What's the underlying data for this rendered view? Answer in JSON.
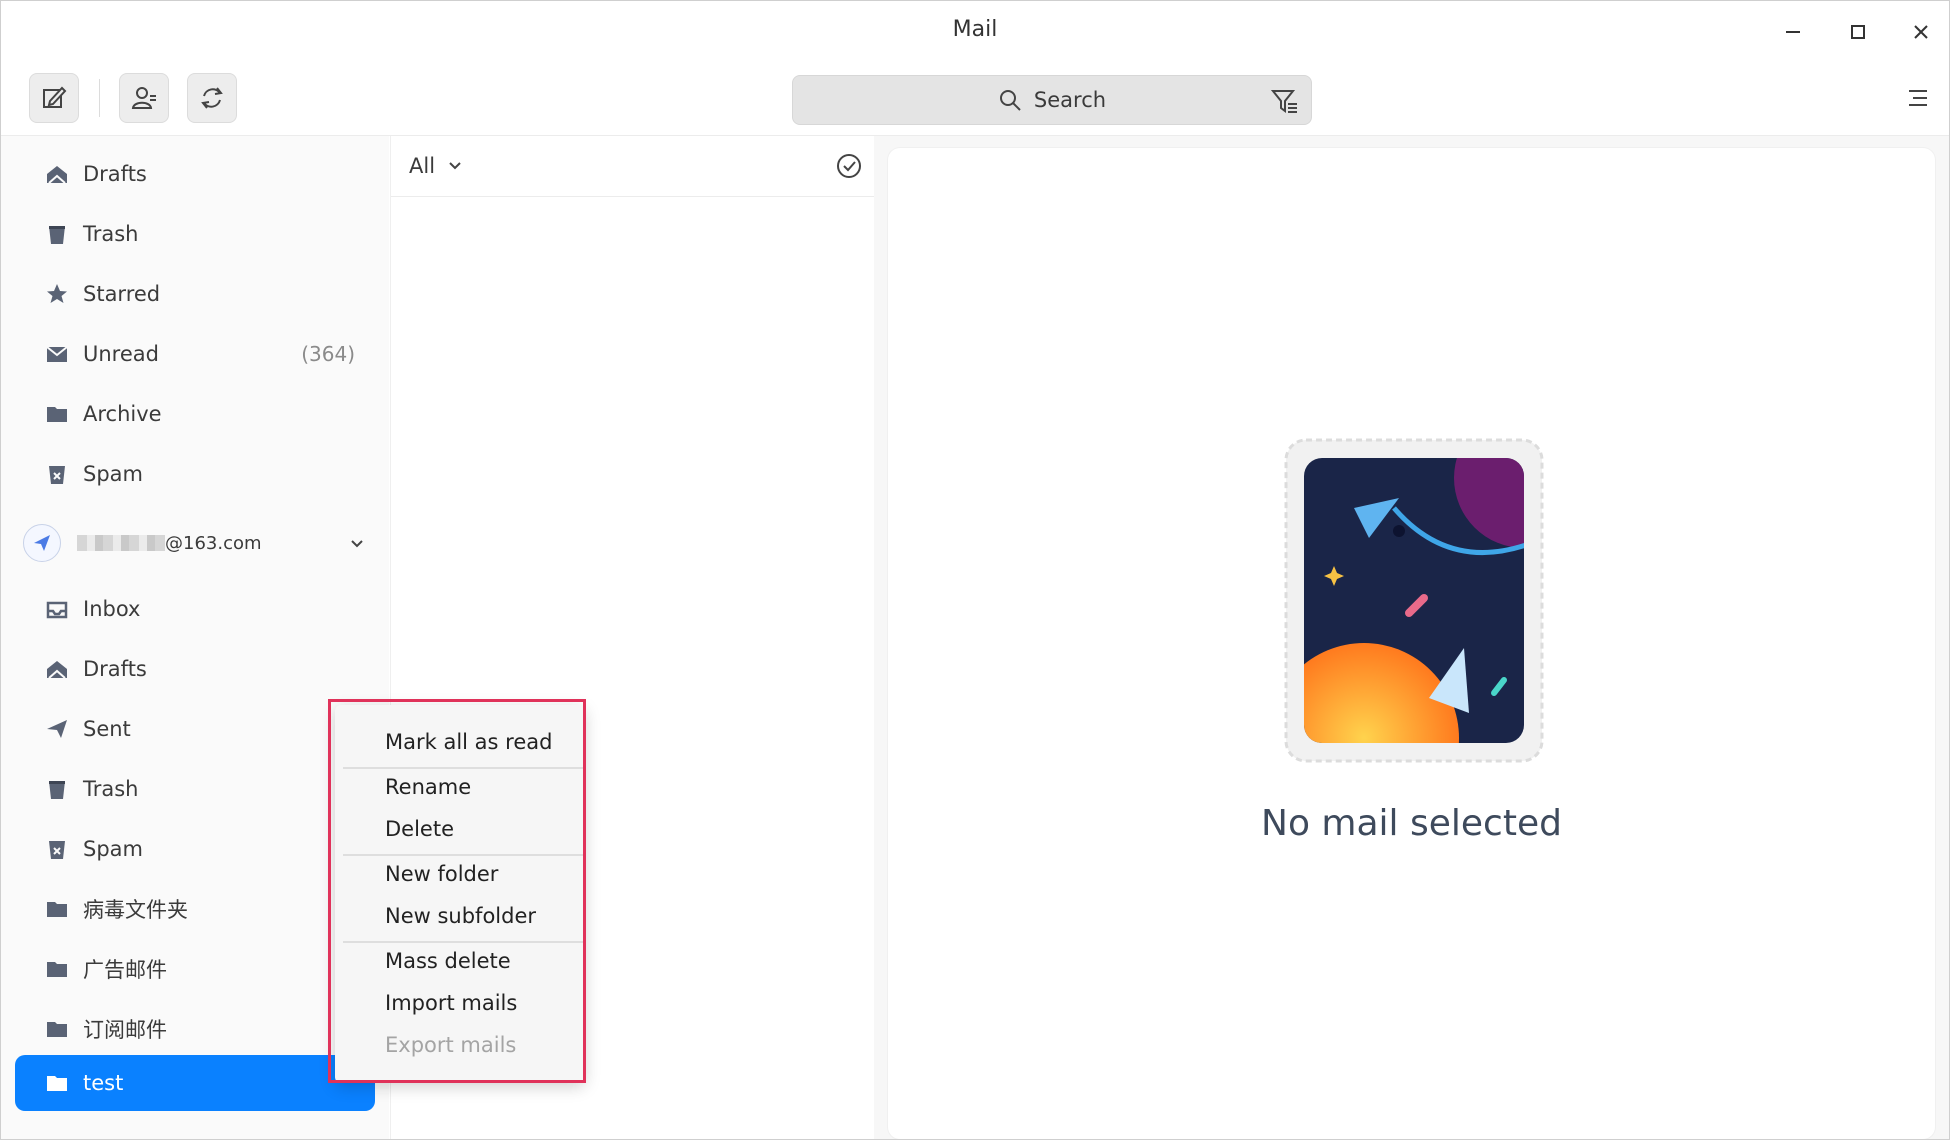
{
  "window": {
    "title": "Mail"
  },
  "toolbar": {
    "compose": "compose",
    "contacts": "contacts",
    "refresh": "refresh",
    "search_placeholder": "Search"
  },
  "sidebar": {
    "top_items": [
      {
        "label": "Drafts",
        "icon": "drafts-icon"
      },
      {
        "label": "Trash",
        "icon": "trash-icon"
      },
      {
        "label": "Starred",
        "icon": "star-icon"
      },
      {
        "label": "Unread",
        "icon": "unread-icon",
        "count": "(364)"
      },
      {
        "label": "Archive",
        "icon": "folder-icon"
      },
      {
        "label": "Spam",
        "icon": "spam-icon"
      }
    ],
    "account": {
      "email": "@163.com"
    },
    "account_items": [
      {
        "label": "Inbox",
        "icon": "inbox-icon"
      },
      {
        "label": "Drafts",
        "icon": "drafts-icon"
      },
      {
        "label": "Sent",
        "icon": "sent-icon"
      },
      {
        "label": "Trash",
        "icon": "trash-icon"
      },
      {
        "label": "Spam",
        "icon": "spam-icon"
      },
      {
        "label": "病毒文件夹",
        "icon": "folder-icon"
      },
      {
        "label": "广告邮件",
        "icon": "folder-icon"
      },
      {
        "label": "订阅邮件",
        "icon": "folder-icon"
      },
      {
        "label": "test",
        "icon": "folder-icon",
        "active": true
      }
    ],
    "partial_count": "("
  },
  "list": {
    "filter_label": "All"
  },
  "reading": {
    "empty_text": "No mail selected"
  },
  "context_menu": {
    "items": [
      {
        "label": "Mark all as read"
      },
      {
        "label": "Rename"
      },
      {
        "label": "Delete"
      },
      {
        "label": "New folder"
      },
      {
        "label": "New subfolder"
      },
      {
        "label": "Mass delete"
      },
      {
        "label": "Import mails"
      },
      {
        "label": "Export mails",
        "disabled": true
      }
    ]
  },
  "colors": {
    "accent": "#0a81ff",
    "highlight": "#e0325a"
  }
}
